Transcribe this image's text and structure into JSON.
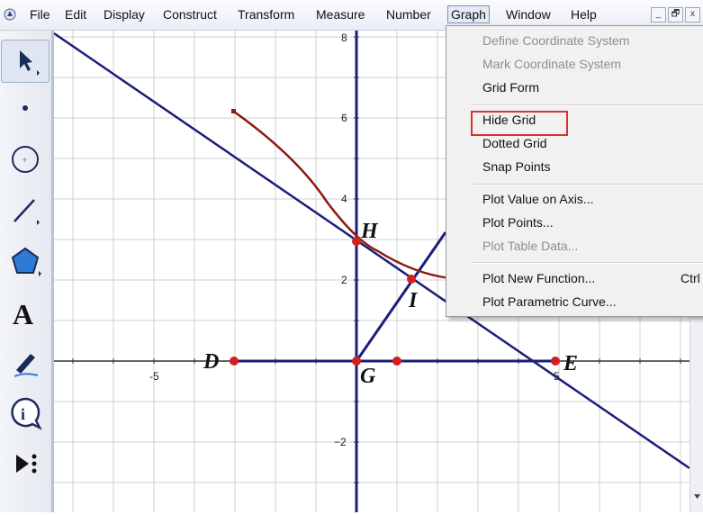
{
  "menubar": {
    "items": [
      "File",
      "Edit",
      "Display",
      "Construct",
      "Transform",
      "Measure",
      "Number",
      "Graph",
      "Window",
      "Help"
    ],
    "active": "Graph",
    "window_buttons": [
      "_",
      "🗗",
      "x"
    ]
  },
  "toolbox": {
    "tools": [
      "arrow-select-tool",
      "point-tool",
      "compass-tool",
      "straightedge-tool",
      "polygon-tool",
      "text-tool",
      "marker-tool",
      "information-tool",
      "custom-tools"
    ],
    "text_tool_glyph": "A",
    "info_tool_glyph": "i"
  },
  "canvas": {
    "axis_labels": {
      "x_neg5": "-5",
      "x_5": "5",
      "y_8": "8",
      "y_6": "6",
      "y_4": "4",
      "y_2": "2",
      "y_neg2": "−2"
    },
    "points": {
      "D": "D",
      "E": "E",
      "G": "G",
      "H": "H",
      "I": "I"
    },
    "colors": {
      "line": "#1b1e7a",
      "curve": "#8a1a14",
      "point": "#d41f1f",
      "grid": "#d0d0d0"
    }
  },
  "graph_menu": {
    "items": [
      {
        "label": "Define Coordinate System",
        "enabled": false
      },
      {
        "label": "Mark Coordinate System",
        "enabled": false
      },
      {
        "label": "Grid Form",
        "enabled": true
      },
      {
        "label": "Hide Grid",
        "enabled": true,
        "highlighted": true
      },
      {
        "label": "Dotted Grid",
        "enabled": true
      },
      {
        "label": "Snap Points",
        "enabled": true
      },
      {
        "label": "Plot Value on Axis...",
        "enabled": true
      },
      {
        "label": "Plot Points...",
        "enabled": true
      },
      {
        "label": "Plot Table Data...",
        "enabled": false
      },
      {
        "label": "Plot New Function...",
        "enabled": true,
        "shortcut": "Ctrl"
      },
      {
        "label": "Plot Parametric Curve...",
        "enabled": true
      }
    ]
  }
}
